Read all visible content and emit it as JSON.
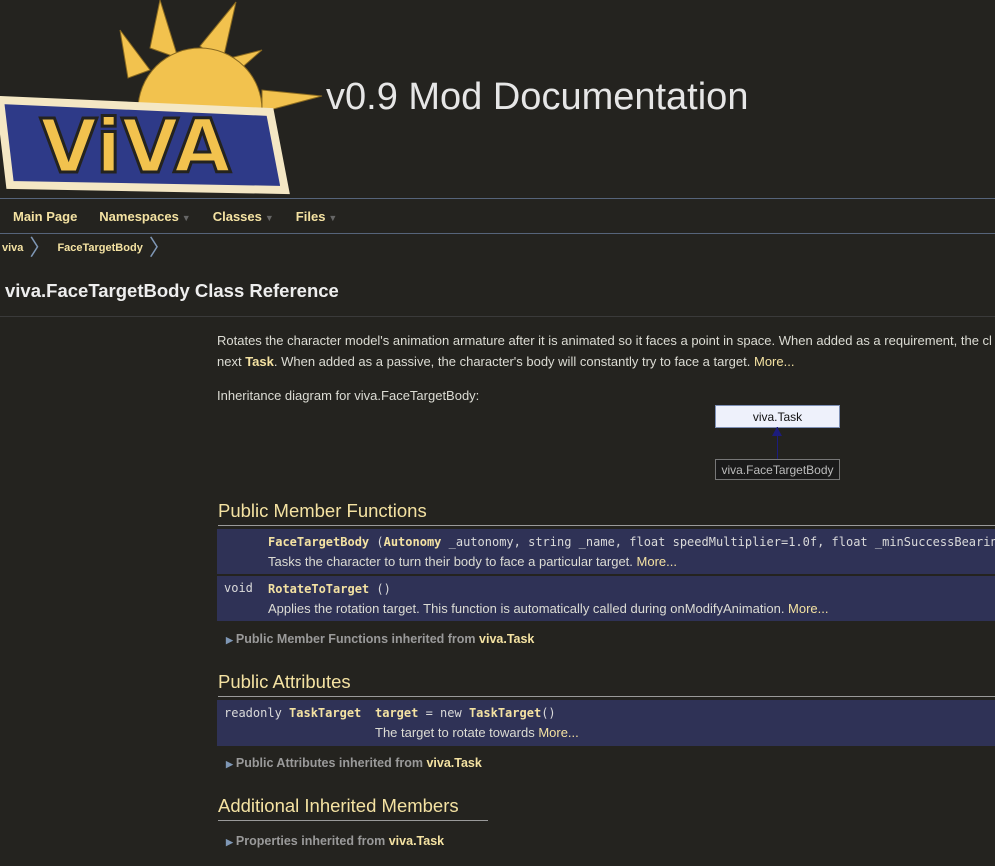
{
  "header": {
    "title": "v0.9 Mod Documentation",
    "logo_text": "ViVA"
  },
  "nav": {
    "main_page": "Main Page",
    "namespaces": "Namespaces",
    "classes": "Classes",
    "files": "Files"
  },
  "breadcrumb": {
    "items": [
      "viva",
      "FaceTargetBody"
    ]
  },
  "page": {
    "title": "viva.FaceTargetBody Class Reference"
  },
  "description": {
    "line1": "Rotates the character model's animation armature after it is animated so it faces a point in space. When added as a requirement, the cl",
    "line2_prefix": "next ",
    "line2_link": "Task",
    "line2_suffix": ". When added as a passive, the character's body will constantly try to face a target. ",
    "more": "More..."
  },
  "inheritance": {
    "label": "Inheritance diagram for viva.FaceTargetBody:",
    "parent": "viva.Task",
    "child": "viva.FaceTargetBody"
  },
  "public_member_functions": {
    "title": "Public Member Functions",
    "members": [
      {
        "type": "",
        "name": "FaceTargetBody",
        "sig_open": " (",
        "param_type": "Autonomy",
        "sig_rest": " _autonomy, string _name, float speedMultiplier=1.0f, float _minSuccessBearin",
        "brief": "Tasks the character to turn their body to face a particular target. ",
        "more": "More..."
      },
      {
        "type": "void",
        "name": "RotateToTarget",
        "sig_rest": " ()",
        "brief": "Applies the rotation target. This function is automatically called during onModifyAnimation. ",
        "more": "More..."
      }
    ],
    "inherited_label": "Public Member Functions inherited from ",
    "inherited_class": "viva.Task"
  },
  "public_attributes": {
    "title": "Public Attributes",
    "member": {
      "type_prefix": "readonly ",
      "type_link": "TaskTarget",
      "name": "target",
      "init_prefix": " = new ",
      "init_link": "TaskTarget",
      "init_suffix": "()",
      "brief": "The target to rotate towards ",
      "more": "More..."
    },
    "inherited_label": "Public Attributes inherited from ",
    "inherited_class": "viva.Task"
  },
  "additional_inherited": {
    "title": "Additional Inherited Members",
    "inherited_label": "Properties inherited from ",
    "inherited_class": "viva.Task"
  }
}
